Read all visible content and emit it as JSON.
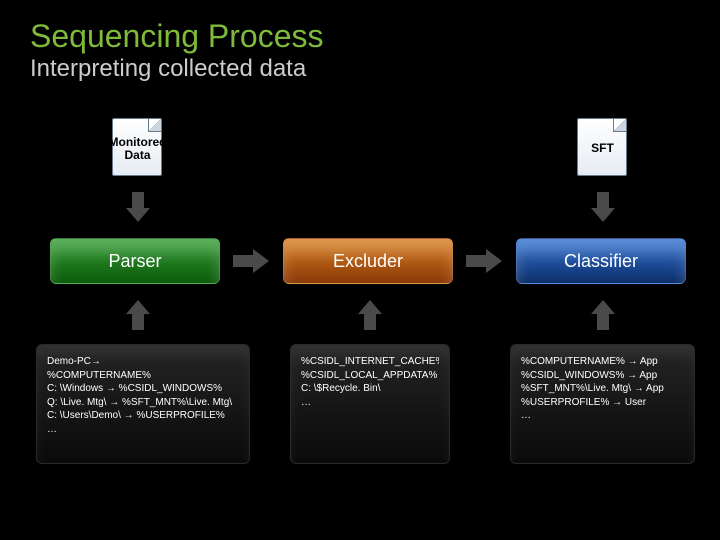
{
  "title": "Sequencing Process",
  "subtitle": "Interpreting collected data",
  "docs": {
    "monitored": {
      "label_l1": "Monitored",
      "label_l2": "Data"
    },
    "sft": {
      "label": "SFT"
    }
  },
  "proc": {
    "parser": "Parser",
    "excluder": "Excluder",
    "classifier": "Classifier"
  },
  "boxes": {
    "parser": [
      "Demo-PC→",
      "%COMPUTERNAME%",
      "C: \\Windows → %CSIDL_WINDOWS%",
      "Q: \\Live. Mtg\\ → %SFT_MNT%\\Live. Mtg\\",
      "C: \\Users\\Demo\\ → %USERPROFILE%",
      "…"
    ],
    "excluder": [
      "%CSIDL_INTERNET_CACHE%",
      "%CSIDL_LOCAL_APPDATA%",
      "C: \\$Recycle. Bin\\",
      "…"
    ],
    "classifier": [
      "%COMPUTERNAME% → App",
      "%CSIDL_WINDOWS% → App",
      "%SFT_MNT%\\Live. Mtg\\ → App",
      "%USERPROFILE% → User",
      "…"
    ]
  }
}
